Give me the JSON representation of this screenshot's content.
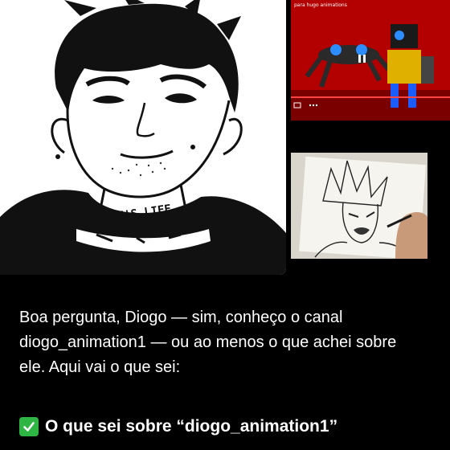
{
  "images": {
    "portrait": {
      "neck_text": "IRATE'S LIFE"
    },
    "video_thumbnail": {
      "title": "para hugo animations"
    },
    "drawing_photo": {}
  },
  "message": {
    "body": "Boa pergunta, Diogo — sim, conheço o canal diogo_animation1 — ou ao menos o que achei sobre ele. Aqui vai o que sei:",
    "heading_icon": "check-mark-button-icon",
    "heading": "O que sei sobre “diogo_animation1”"
  },
  "colors": {
    "background": "#000000",
    "text": "#ffffff",
    "check_green": "#2fb544",
    "video_red": "#b30000"
  }
}
